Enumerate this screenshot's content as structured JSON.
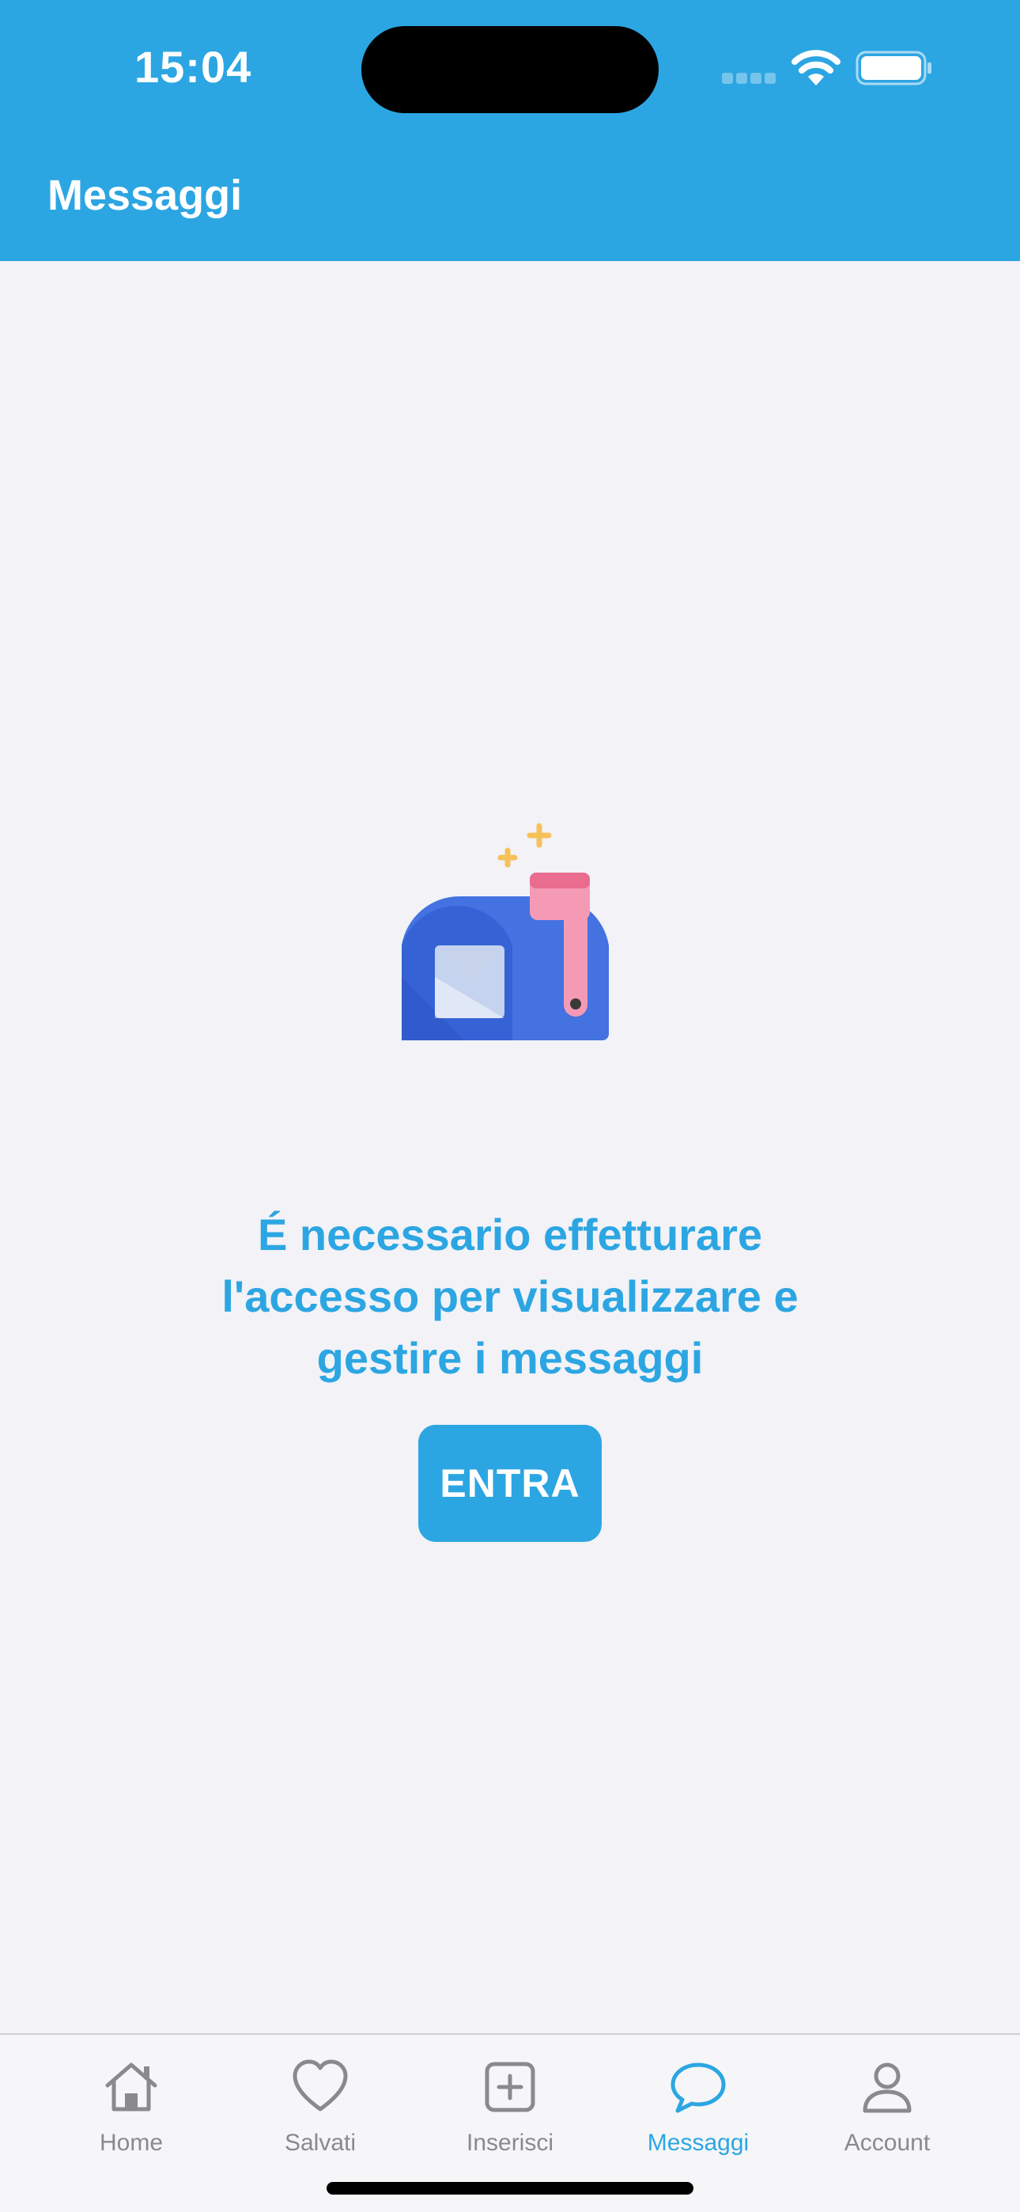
{
  "status_bar": {
    "time": "15:04"
  },
  "header": {
    "title": "Messaggi",
    "background_color": "#2ca6e2"
  },
  "empty_state": {
    "illustration": "mailbox-icon",
    "message": "É necessario effetturare l'accesso per visualizzare e gestire i messaggi",
    "button_label": "ENTRA",
    "accent_color": "#2ca6e2"
  },
  "tabbar": {
    "active_color": "#2ca6e2",
    "inactive_color": "#8a8a8e",
    "items": [
      {
        "label": "Home",
        "icon": "home-icon",
        "active": false
      },
      {
        "label": "Salvati",
        "icon": "heart-icon",
        "active": false
      },
      {
        "label": "Inserisci",
        "icon": "plus-square-icon",
        "active": false
      },
      {
        "label": "Messaggi",
        "icon": "chat-bubble-icon",
        "active": true
      },
      {
        "label": "Account",
        "icon": "person-icon",
        "active": false
      }
    ]
  }
}
